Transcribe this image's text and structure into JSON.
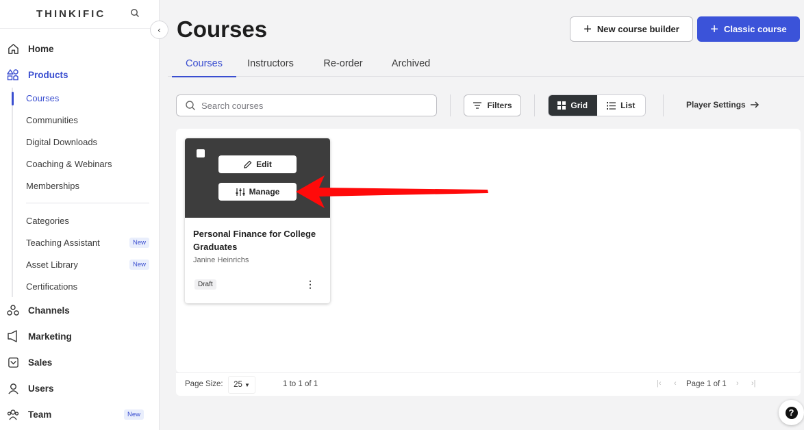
{
  "brand": {
    "name": "THINKIFIC"
  },
  "sidebar": {
    "main_top": [
      {
        "label": "Home",
        "icon": "home-icon"
      },
      {
        "label": "Products",
        "icon": "products-icon",
        "active": true
      }
    ],
    "products_sub": [
      {
        "label": "Courses",
        "active": true
      },
      {
        "label": "Communities"
      },
      {
        "label": "Digital Downloads"
      },
      {
        "label": "Coaching & Webinars"
      },
      {
        "label": "Memberships"
      }
    ],
    "products_sub2": [
      {
        "label": "Categories"
      },
      {
        "label": "Teaching Assistant",
        "badge": "New"
      },
      {
        "label": "Asset Library",
        "badge": "New"
      },
      {
        "label": "Certifications"
      }
    ],
    "main_bottom": [
      {
        "label": "Channels",
        "icon": "channels-icon"
      },
      {
        "label": "Marketing",
        "icon": "marketing-icon"
      },
      {
        "label": "Sales",
        "icon": "sales-icon"
      },
      {
        "label": "Users",
        "icon": "user-icon"
      },
      {
        "label": "Team",
        "icon": "team-icon",
        "badge": "New"
      }
    ]
  },
  "header": {
    "title": "Courses",
    "new_builder_label": "New course builder",
    "classic_label": "Classic course"
  },
  "tabs": [
    {
      "label": "Courses",
      "active": true
    },
    {
      "label": "Instructors"
    },
    {
      "label": "Re-order"
    },
    {
      "label": "Archived"
    }
  ],
  "toolbar": {
    "search_placeholder": "Search courses",
    "filters_label": "Filters",
    "grid_label": "Grid",
    "list_label": "List",
    "player_settings_label": "Player Settings"
  },
  "course_card": {
    "edit_label": "Edit",
    "manage_label": "Manage",
    "title": "Personal Finance for College Graduates",
    "author": "Janine Heinrichs",
    "status": "Draft"
  },
  "pager": {
    "page_size_label": "Page Size:",
    "page_size": "25",
    "range": "1 to 1 of 1",
    "page_info": "Page 1 of 1"
  },
  "colors": {
    "accent": "#3b53d9",
    "annotation_arrow": "#ff0a0a",
    "thumb_bg": "#3d3d3d"
  }
}
